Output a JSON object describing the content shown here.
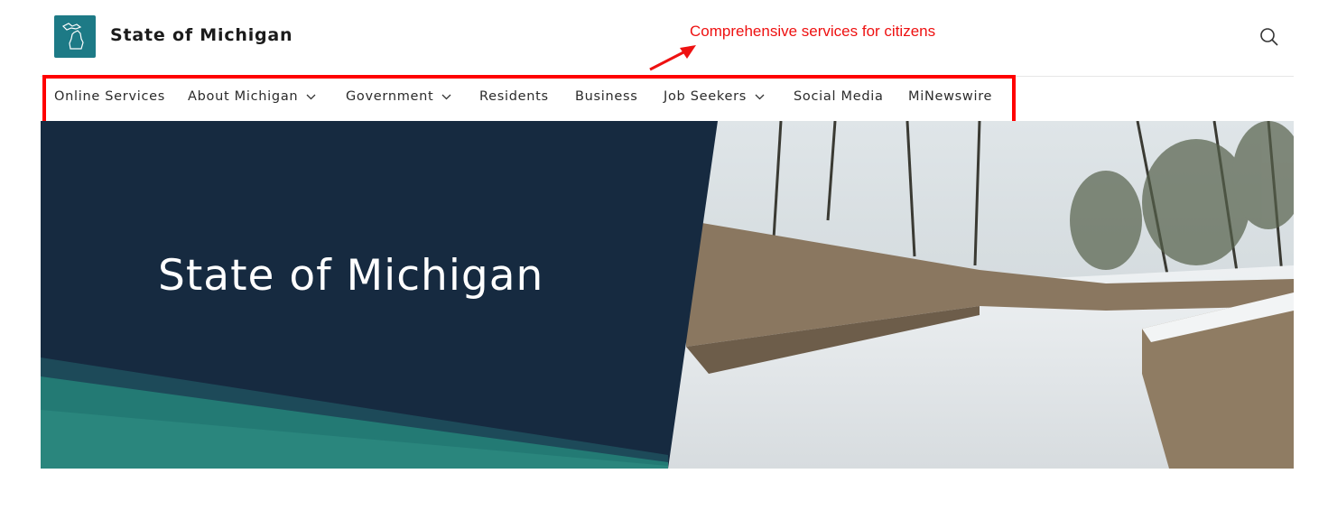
{
  "header": {
    "brand": "State of Michigan",
    "logo_icon": "michigan-map-icon",
    "search_icon": "search-icon"
  },
  "annotation": {
    "text": "Comprehensive services for citizens",
    "color": "#ee1111"
  },
  "nav": {
    "items": [
      {
        "label": "Online Services",
        "dropdown": false
      },
      {
        "label": "About Michigan",
        "dropdown": true
      },
      {
        "label": "Government",
        "dropdown": true
      },
      {
        "label": "Residents",
        "dropdown": false
      },
      {
        "label": "Business",
        "dropdown": false
      },
      {
        "label": "Job Seekers",
        "dropdown": true
      },
      {
        "label": "Social Media",
        "dropdown": false
      },
      {
        "label": "MiNewswire",
        "dropdown": false
      }
    ]
  },
  "hero": {
    "title": "State of Michigan"
  },
  "colors": {
    "logo_bg": "#1d7a86",
    "hero_dark": "#162a40",
    "hero_teal": "#237a74",
    "highlight": "#ff0000"
  }
}
